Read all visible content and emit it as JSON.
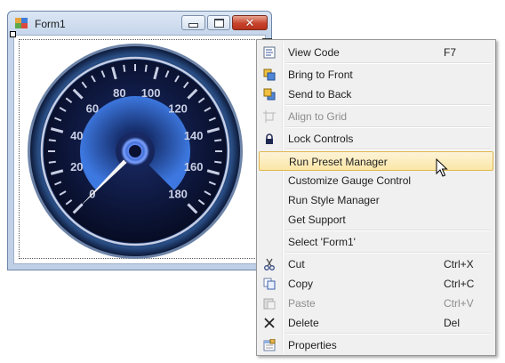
{
  "form": {
    "title": "Form1"
  },
  "gauge": {
    "scale_labels": [
      "0",
      "20",
      "40",
      "60",
      "80",
      "100",
      "120",
      "140",
      "160",
      "180"
    ],
    "range_min": 0,
    "range_max": 180,
    "needle_value": 0,
    "colors": {
      "rim": "#1c3a66",
      "face": "#0b1233",
      "accent": "#2f67c7",
      "label": "#c9cfe4"
    }
  },
  "context_menu": {
    "highlight_color": "#fbe6a6",
    "items": [
      {
        "label": "View Code",
        "shortcut": "F7",
        "icon": "view-code-icon",
        "disabled": false
      },
      {
        "label": "Bring to Front",
        "shortcut": "",
        "icon": "bring-to-front-icon",
        "disabled": false
      },
      {
        "label": "Send to Back",
        "shortcut": "",
        "icon": "send-to-back-icon",
        "disabled": false
      },
      {
        "label": "Align to Grid",
        "shortcut": "",
        "icon": "align-to-grid-icon",
        "disabled": true
      },
      {
        "label": "Lock Controls",
        "shortcut": "",
        "icon": "lock-icon",
        "disabled": false
      },
      {
        "label": "Run Preset Manager",
        "shortcut": "",
        "icon": "",
        "disabled": false,
        "highlighted": true
      },
      {
        "label": "Customize Gauge Control",
        "shortcut": "",
        "icon": "",
        "disabled": false
      },
      {
        "label": "Run Style Manager",
        "shortcut": "",
        "icon": "",
        "disabled": false
      },
      {
        "label": "Get Support",
        "shortcut": "",
        "icon": "",
        "disabled": false
      },
      {
        "label": "Select 'Form1'",
        "shortcut": "",
        "icon": "",
        "disabled": false
      },
      {
        "label": "Cut",
        "shortcut": "Ctrl+X",
        "icon": "cut-icon",
        "disabled": false
      },
      {
        "label": "Copy",
        "shortcut": "Ctrl+C",
        "icon": "copy-icon",
        "disabled": false
      },
      {
        "label": "Paste",
        "shortcut": "Ctrl+V",
        "icon": "paste-icon",
        "disabled": true
      },
      {
        "label": "Delete",
        "shortcut": "Del",
        "icon": "delete-icon",
        "disabled": false
      },
      {
        "label": "Properties",
        "shortcut": "",
        "icon": "properties-icon",
        "disabled": false
      }
    ]
  }
}
